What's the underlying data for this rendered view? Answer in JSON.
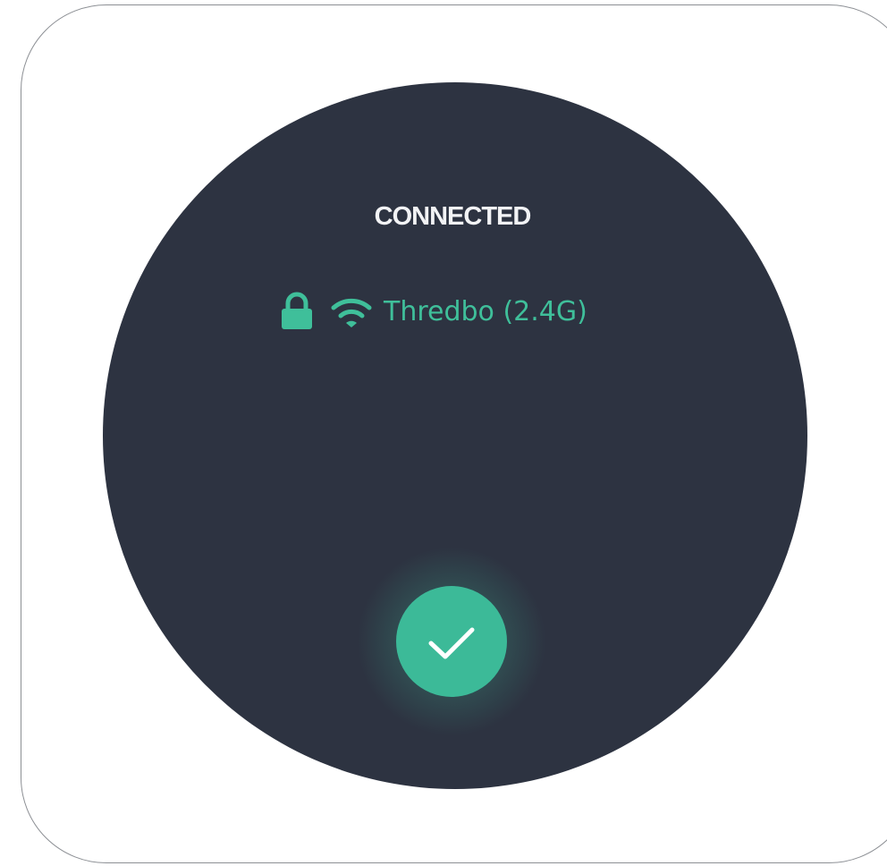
{
  "status": {
    "title": "CONNECTED"
  },
  "network": {
    "name": "Thredbo (2.4G)",
    "security_icon": "lock-icon",
    "signal_icon": "wifi-icon"
  },
  "action": {
    "icon": "check-icon"
  },
  "colors": {
    "accent": "#3fbf9a",
    "dial_background": "#2d3341",
    "title_text": "#f2f3f5"
  }
}
